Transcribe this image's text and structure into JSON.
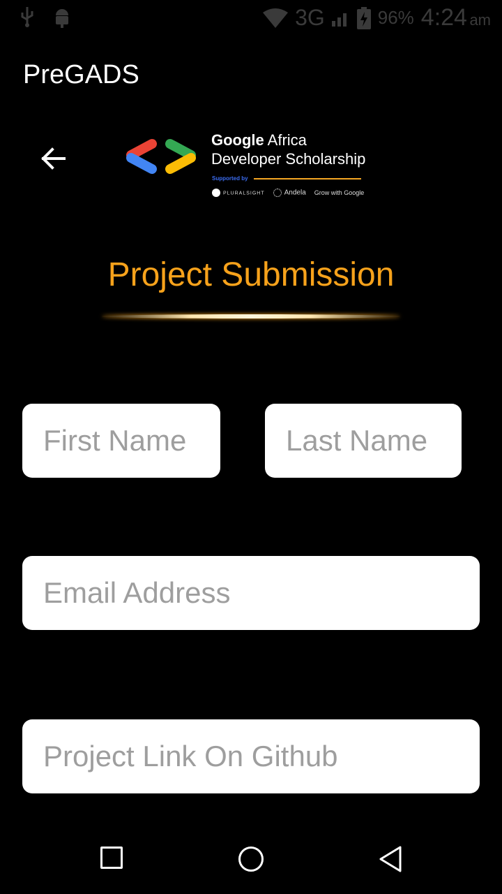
{
  "status_bar": {
    "network": "3G",
    "battery": "96%",
    "time": "4:24",
    "ampm": "am"
  },
  "app": {
    "title": "PreGADS"
  },
  "logo": {
    "line1_bold": "Google",
    "line1_rest": " Africa",
    "line2": "Developer Scholarship",
    "supported_by": "Supported by",
    "partners": [
      "PLURALSIGHT",
      "Andela",
      "Grow with Google"
    ]
  },
  "heading": "Project Submission",
  "form": {
    "first_name_placeholder": "First Name",
    "last_name_placeholder": "Last Name",
    "email_placeholder": "Email Address",
    "github_placeholder": "Project Link On Github"
  },
  "colors": {
    "accent": "#f7a21b",
    "background": "#000000",
    "field_bg": "#ffffff",
    "placeholder": "#9e9e9e"
  },
  "icons": {
    "back": "arrow-left-icon",
    "nav_recents": "square-icon",
    "nav_home": "circle-icon",
    "nav_back": "triangle-icon"
  }
}
